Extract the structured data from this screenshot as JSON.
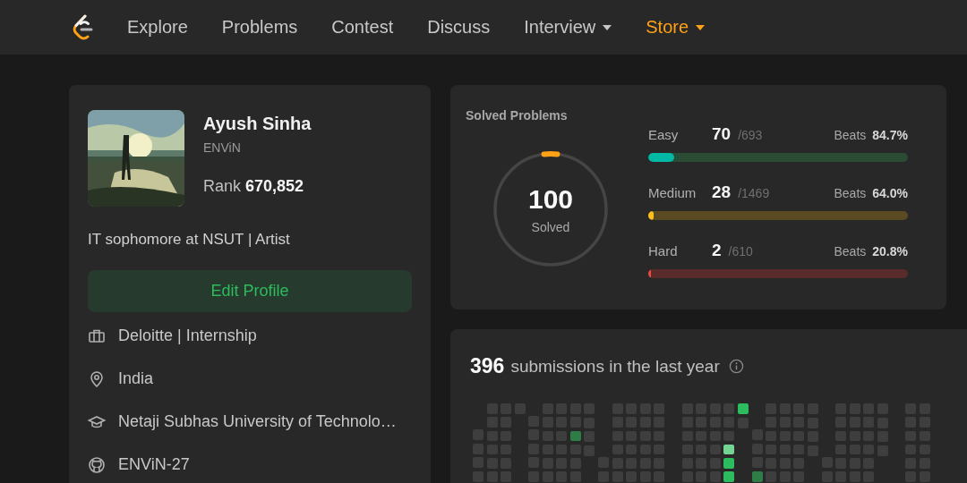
{
  "nav": {
    "items": [
      {
        "label": "Explore",
        "dropdown": false,
        "highlighted": false
      },
      {
        "label": "Problems",
        "dropdown": false,
        "highlighted": false
      },
      {
        "label": "Contest",
        "dropdown": false,
        "highlighted": false
      },
      {
        "label": "Discuss",
        "dropdown": false,
        "highlighted": false
      },
      {
        "label": "Interview",
        "dropdown": true,
        "highlighted": false
      },
      {
        "label": "Store",
        "dropdown": true,
        "highlighted": true
      }
    ]
  },
  "profile": {
    "name": "Ayush Sinha",
    "username": "ENViN",
    "rank_label": "Rank",
    "rank": "670,852",
    "bio": "IT sophomore at NSUT | Artist",
    "edit_button": "Edit Profile",
    "details": [
      {
        "kind": "work",
        "text": "Deloitte | Internship"
      },
      {
        "kind": "location",
        "text": "India"
      },
      {
        "kind": "school",
        "text": "Netaji Subhas University of Technolo…"
      },
      {
        "kind": "github",
        "text": "ENViN-27"
      }
    ]
  },
  "solved": {
    "title": "Solved Problems",
    "total": "100",
    "total_label": "Solved",
    "difficulties": [
      {
        "kind": "easy",
        "name": "Easy",
        "solved": "70",
        "total": "/693",
        "beats_label": "Beats",
        "beats": "84.7%",
        "level": 0.101
      },
      {
        "kind": "medium",
        "name": "Medium",
        "solved": "28",
        "total": "/1469",
        "beats_label": "Beats",
        "beats": "64.0%",
        "level": 0.019
      },
      {
        "kind": "hard",
        "name": "Hard",
        "solved": "2",
        "total": "/610",
        "beats_label": "Beats",
        "beats": "20.8%",
        "level": 0.003
      }
    ]
  },
  "submissions": {
    "count": "396",
    "text": "submissions in the last year",
    "months": [
      {
        "weeks": [
          {
            "kind": "bottom",
            "days": [
              {
                "color": "#3e3e3e"
              },
              {
                "color": "#3e3e3e"
              },
              {
                "color": "#3e3e3e"
              },
              {
                "color": "#3e3e3e"
              }
            ]
          },
          {
            "kind": "full",
            "days": [
              {
                "color": "#3e3e3e"
              },
              {
                "color": "#3e3e3e"
              },
              {
                "color": "#3e3e3e"
              },
              {
                "color": "#3e3e3e"
              },
              {
                "color": "#3e3e3e"
              },
              {
                "color": "#3e3e3e"
              }
            ]
          },
          {
            "kind": "full",
            "days": [
              {
                "color": "#3e3e3e"
              },
              {
                "color": "#3e3e3e"
              },
              {
                "color": "#3e3e3e"
              },
              {
                "color": "#3e3e3e"
              },
              {
                "color": "#3e3e3e"
              },
              {
                "color": "#3e3e3e"
              }
            ]
          },
          {
            "kind": "top",
            "days": [
              {
                "color": "#3e3e3e"
              }
            ]
          },
          {
            "kind": "bottom",
            "days": [
              {
                "color": "#3e3e3e"
              },
              {
                "color": "#3e3e3e"
              },
              {
                "color": "#3e3e3e"
              },
              {
                "color": "#3e3e3e"
              },
              {
                "color": "#3e3e3e"
              }
            ]
          },
          {
            "kind": "full",
            "days": [
              {
                "color": "#3e3e3e"
              },
              {
                "color": "#3e3e3e"
              },
              {
                "color": "#3e3e3e"
              },
              {
                "color": "#3e3e3e"
              },
              {
                "color": "#3e3e3e"
              },
              {
                "color": "#3e3e3e"
              }
            ]
          },
          {
            "kind": "full",
            "days": [
              {
                "color": "#3e3e3e"
              },
              {
                "color": "#3e3e3e"
              },
              {
                "color": "#3e3e3e"
              },
              {
                "color": "#3e3e3e"
              },
              {
                "color": "#3e3e3e"
              },
              {
                "color": "#3e3e3e"
              }
            ]
          },
          {
            "kind": "full",
            "days": [
              {
                "color": "#3e3e3e"
              },
              {
                "color": "#3e3e3e"
              },
              {
                "color": "#2e7d46"
              },
              {
                "color": "#3e3e3e"
              },
              {
                "color": "#3e3e3e"
              },
              {
                "color": "#3e3e3e"
              }
            ]
          },
          {
            "kind": "top",
            "days": [
              {
                "color": "#3e3e3e"
              },
              {
                "color": "#3e3e3e"
              },
              {
                "color": "#3e3e3e"
              },
              {
                "color": "#3e3e3e"
              }
            ]
          }
        ]
      },
      {
        "weeks": [
          {
            "kind": "bottom",
            "days": [
              {
                "color": "#3e3e3e"
              },
              {
                "color": "#3e3e3e"
              }
            ]
          },
          {
            "kind": "full",
            "days": [
              {
                "color": "#3e3e3e"
              },
              {
                "color": "#3e3e3e"
              },
              {
                "color": "#3e3e3e"
              },
              {
                "color": "#3e3e3e"
              },
              {
                "color": "#3e3e3e"
              },
              {
                "color": "#3e3e3e"
              }
            ]
          },
          {
            "kind": "full",
            "days": [
              {
                "color": "#3e3e3e"
              },
              {
                "color": "#3e3e3e"
              },
              {
                "color": "#3e3e3e"
              },
              {
                "color": "#3e3e3e"
              },
              {
                "color": "#3e3e3e"
              },
              {
                "color": "#3e3e3e"
              }
            ]
          },
          {
            "kind": "full",
            "days": [
              {
                "color": "#3e3e3e"
              },
              {
                "color": "#3e3e3e"
              },
              {
                "color": "#3e3e3e"
              },
              {
                "color": "#3e3e3e"
              },
              {
                "color": "#3e3e3e"
              },
              {
                "color": "#3e3e3e"
              }
            ]
          },
          {
            "kind": "full",
            "days": [
              {
                "color": "#3e3e3e"
              },
              {
                "color": "#3e3e3e"
              },
              {
                "color": "#3e3e3e"
              },
              {
                "color": "#3e3e3e"
              },
              {
                "color": "#3e3e3e"
              },
              {
                "color": "#3e3e3e"
              }
            ]
          }
        ]
      },
      {
        "weeks": [
          {
            "kind": "blank"
          },
          {
            "kind": "full",
            "days": [
              {
                "color": "#3e3e3e"
              },
              {
                "color": "#3e3e3e"
              },
              {
                "color": "#3e3e3e"
              },
              {
                "color": "#3e3e3e"
              },
              {
                "color": "#3e3e3e"
              },
              {
                "color": "#3e3e3e"
              }
            ]
          },
          {
            "kind": "full",
            "days": [
              {
                "color": "#3e3e3e"
              },
              {
                "color": "#3e3e3e"
              },
              {
                "color": "#3e3e3e"
              },
              {
                "color": "#3e3e3e"
              },
              {
                "color": "#3e3e3e"
              },
              {
                "color": "#3e3e3e"
              }
            ]
          },
          {
            "kind": "full",
            "days": [
              {
                "color": "#3e3e3e"
              },
              {
                "color": "#3e3e3e"
              },
              {
                "color": "#3e3e3e"
              },
              {
                "color": "#3e3e3e"
              },
              {
                "color": "#3e3e3e"
              },
              {
                "color": "#3e3e3e"
              }
            ]
          },
          {
            "kind": "full",
            "days": [
              {
                "color": "#3e3e3e"
              },
              {
                "color": "#3e3e3e"
              },
              {
                "color": "#3e3e3e"
              },
              {
                "color": "#74d493"
              },
              {
                "color": "#2cbb5d"
              },
              {
                "color": "#2cbb5d"
              }
            ]
          },
          {
            "kind": "top",
            "days": [
              {
                "color": "#2cbb5d"
              },
              {
                "color": "#3e3e3e"
              }
            ]
          }
        ]
      },
      {
        "weeks": [
          {
            "kind": "bottom",
            "days": [
              {
                "color": "#3e3e3e"
              },
              {
                "color": "#3e3e3e"
              },
              {
                "color": "#3e3e3e"
              },
              {
                "color": "#2e7d46"
              }
            ]
          },
          {
            "kind": "full",
            "days": [
              {
                "color": "#3e3e3e"
              },
              {
                "color": "#3e3e3e"
              },
              {
                "color": "#3e3e3e"
              },
              {
                "color": "#3e3e3e"
              },
              {
                "color": "#3e3e3e"
              },
              {
                "color": "#3e3e3e"
              }
            ]
          },
          {
            "kind": "full",
            "days": [
              {
                "color": "#3e3e3e"
              },
              {
                "color": "#3e3e3e"
              },
              {
                "color": "#3e3e3e"
              },
              {
                "color": "#3e3e3e"
              },
              {
                "color": "#3e3e3e"
              },
              {
                "color": "#3e3e3e"
              }
            ]
          },
          {
            "kind": "full",
            "days": [
              {
                "color": "#3e3e3e"
              },
              {
                "color": "#3e3e3e"
              },
              {
                "color": "#3e3e3e"
              },
              {
                "color": "#3e3e3e"
              },
              {
                "color": "#3e3e3e"
              },
              {
                "color": "#3e3e3e"
              }
            ]
          },
          {
            "kind": "top",
            "days": [
              {
                "color": "#3e3e3e"
              },
              {
                "color": "#3e3e3e"
              },
              {
                "color": "#3e3e3e"
              },
              {
                "color": "#3e3e3e"
              }
            ]
          }
        ]
      },
      {
        "weeks": [
          {
            "kind": "bottom",
            "days": [
              {
                "color": "#3e3e3e"
              },
              {
                "color": "#3e3e3e"
              }
            ]
          },
          {
            "kind": "full",
            "days": [
              {
                "color": "#3e3e3e"
              },
              {
                "color": "#3e3e3e"
              },
              {
                "color": "#3e3e3e"
              },
              {
                "color": "#3e3e3e"
              },
              {
                "color": "#3e3e3e"
              },
              {
                "color": "#3e3e3e"
              }
            ]
          },
          {
            "kind": "full",
            "days": [
              {
                "color": "#3e3e3e"
              },
              {
                "color": "#3e3e3e"
              },
              {
                "color": "#3e3e3e"
              },
              {
                "color": "#3e3e3e"
              },
              {
                "color": "#3e3e3e"
              },
              {
                "color": "#3e3e3e"
              }
            ]
          },
          {
            "kind": "full",
            "days": [
              {
                "color": "#3e3e3e"
              },
              {
                "color": "#3e3e3e"
              },
              {
                "color": "#3e3e3e"
              },
              {
                "color": "#3e3e3e"
              },
              {
                "color": "#3e3e3e"
              },
              {
                "color": "#3e3e3e"
              }
            ]
          },
          {
            "kind": "top",
            "days": [
              {
                "color": "#3e3e3e"
              },
              {
                "color": "#3e3e3e"
              },
              {
                "color": "#3e3e3e"
              },
              {
                "color": "#3e3e3e"
              }
            ]
          }
        ]
      },
      {
        "weeks": [
          {
            "kind": "blank"
          },
          {
            "kind": "full",
            "days": [
              {
                "color": "#3e3e3e"
              },
              {
                "color": "#3e3e3e"
              },
              {
                "color": "#3e3e3e"
              },
              {
                "color": "#3e3e3e"
              },
              {
                "color": "#3e3e3e"
              },
              {
                "color": "#3e3e3e"
              }
            ]
          },
          {
            "kind": "full",
            "days": [
              {
                "color": "#3e3e3e"
              },
              {
                "color": "#3e3e3e"
              },
              {
                "color": "#3e3e3e"
              },
              {
                "color": "#3e3e3e"
              },
              {
                "color": "#3e3e3e"
              },
              {
                "color": "#3e3e3e"
              }
            ]
          }
        ]
      }
    ]
  }
}
